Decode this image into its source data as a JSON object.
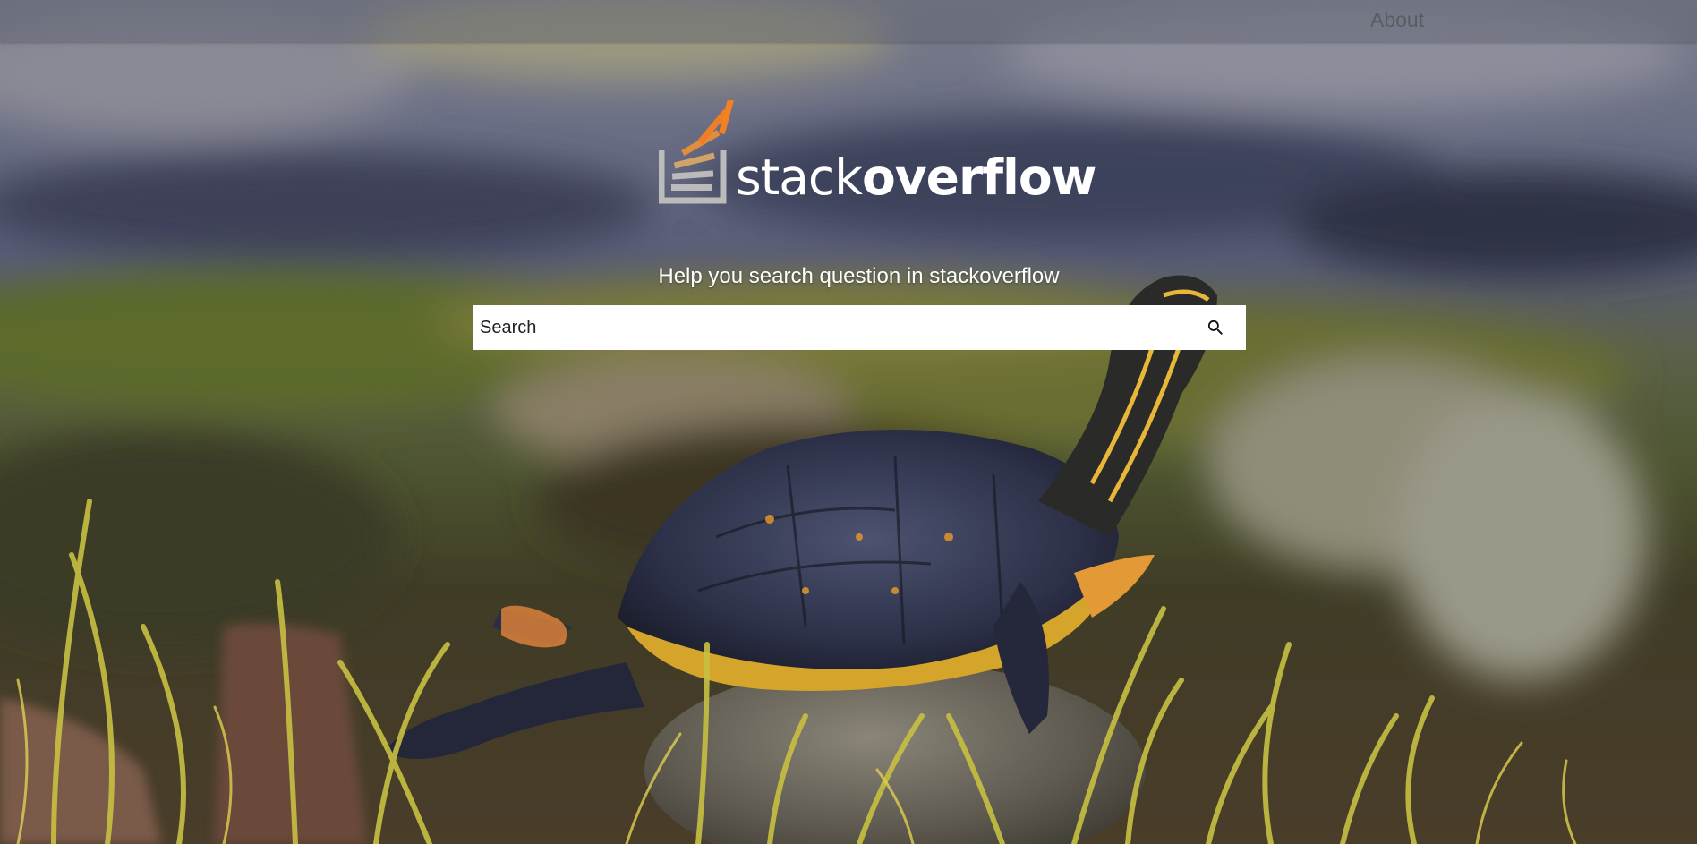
{
  "nav": {
    "about_label": "About"
  },
  "logo": {
    "word_light": "stack",
    "word_bold": "overflow",
    "icon": "stackoverflow-logo-icon",
    "accent_color": "#f48024"
  },
  "hero": {
    "tagline": "Help you search question in stackoverflow"
  },
  "search": {
    "placeholder": "Search",
    "value": "",
    "icon": "search-icon"
  },
  "background": {
    "description_icon": "turtle-photo"
  }
}
